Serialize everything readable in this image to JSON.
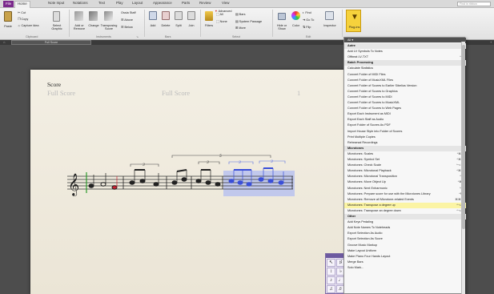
{
  "ribbon_tabs": [
    "File",
    "Home",
    "Note Input",
    "Notations",
    "Text",
    "Play",
    "Layout",
    "Appearance",
    "Parts",
    "Review",
    "View"
  ],
  "active_tab": "Home",
  "find_placeholder": "Find in ribbon",
  "clipboard": {
    "paste": "Paste",
    "cut": "Cut",
    "copy": "Copy",
    "capture_idea": "Capture Idea",
    "select_graphic": "Select Graphic",
    "label": "Clipboard"
  },
  "instruments": {
    "add_remove": "Add or Remove",
    "change": "Change",
    "transposing_score": "Transposing Score",
    "ossia_staff": "Ossia Staff",
    "above": "Above",
    "below": "Below",
    "label": "Instruments"
  },
  "bars": {
    "add": "Add",
    "delete": "Delete",
    "split": "Split",
    "join": "Join",
    "label": "Bars"
  },
  "select": {
    "filters": "Filters",
    "all": "All",
    "none": "None",
    "advanced": "Advanced",
    "system_passage": "System Passage",
    "more": "More",
    "bars": "Bars",
    "label": "Select"
  },
  "edit": {
    "hide_or_show": "Hide or Show",
    "color": "Color",
    "inspector": "Inspector",
    "find": "Find",
    "go_to": "Go To",
    "flip": "Flip",
    "label": "Edit"
  },
  "plugins": {
    "label": "Plug-ins"
  },
  "doc_tab": "Full Score",
  "score": {
    "title": "Score",
    "subtitle": "Full Score",
    "center": "Full Score",
    "page_number": "1"
  },
  "menu_scroll_label": "All",
  "menu_rows": [
    {
      "text": "Autre",
      "head": true
    },
    {
      "text": "Add LV Symbols To Notes"
    },
    {
      "text": "Offbeat LV-TXT",
      "short": "^F"
    },
    {
      "text": "Batch Processing",
      "head": true
    },
    {
      "text": "Calculate Statistics"
    },
    {
      "text": "Convert Folder of MIDI Files"
    },
    {
      "text": "Convert Folder of MusicXML Files"
    },
    {
      "text": "Convert Folder of Scores to Earlier Sibelius Version"
    },
    {
      "text": "Convert Folder of Scores to Graphics"
    },
    {
      "text": "Convert Folder of Scores to MIDI"
    },
    {
      "text": "Convert Folder of Scores to MusicXML"
    },
    {
      "text": "Convert Folder of Scores to Web Pages"
    },
    {
      "text": "Export Each Instrument as MIDI"
    },
    {
      "text": "Export Each Staff as Audio"
    },
    {
      "text": "Export Folder of Scores As PDF"
    },
    {
      "text": "Import House Style into Folder of Scores"
    },
    {
      "text": "Print Multiple Copies"
    },
    {
      "text": "Rehearsal Recordings"
    },
    {
      "text": "Microtones",
      "head": true
    },
    {
      "text": "Microtones: Scales",
      "short": "^⌘L"
    },
    {
      "text": "Microtones: Symbol Set",
      "short": "^⌘F"
    },
    {
      "text": "Microtones: Check Scale",
      "short": "^⌥T"
    },
    {
      "text": "Microtones: Microtonal Playback",
      "short": "^⌘K"
    },
    {
      "text": "Microtones: Microtonal Transposition",
      "short": "^T"
    },
    {
      "text": "Microtones: Move Object Up",
      "short": "^⌘I"
    },
    {
      "text": "Microtones: Next Enharmonic",
      "short": "^E"
    },
    {
      "text": "Microtones: Prepare score for use with the Microtones Library",
      "short": "^M"
    },
    {
      "text": "Microtones: Remove all Microtone-related Events",
      "short": "⌘⌘E"
    },
    {
      "text": "Microtones: Transpose a degree up",
      "short": "^⌥↑",
      "hl": true
    },
    {
      "text": "Microtones: Transpose an degree down",
      "short": "^⌥↓"
    },
    {
      "text": "Other",
      "head": true
    },
    {
      "text": "Add Keys Pedaling"
    },
    {
      "text": "Add Note Names To Noteheads"
    },
    {
      "text": "Export Selection As Audio"
    },
    {
      "text": "Export Selection As Score"
    },
    {
      "text": "Groove Music Markup"
    },
    {
      "text": "Make Layout Uniform"
    },
    {
      "text": "Make Piano Four Hands Layout"
    },
    {
      "text": "Merge Bars"
    },
    {
      "text": "Solo Mark..."
    }
  ],
  "keypad_keys": [
    "↖",
    "♯",
    "↕",
    "♭",
    "♪",
    "♩",
    "♫",
    "♬",
    "1.",
    "7",
    "8",
    "9"
  ],
  "colors": {
    "file_tab": "#7b2a8c",
    "plugin_button": "#f6d23c",
    "selection": "#7a8ff0",
    "menu_highlight": "#fbf4a4"
  }
}
